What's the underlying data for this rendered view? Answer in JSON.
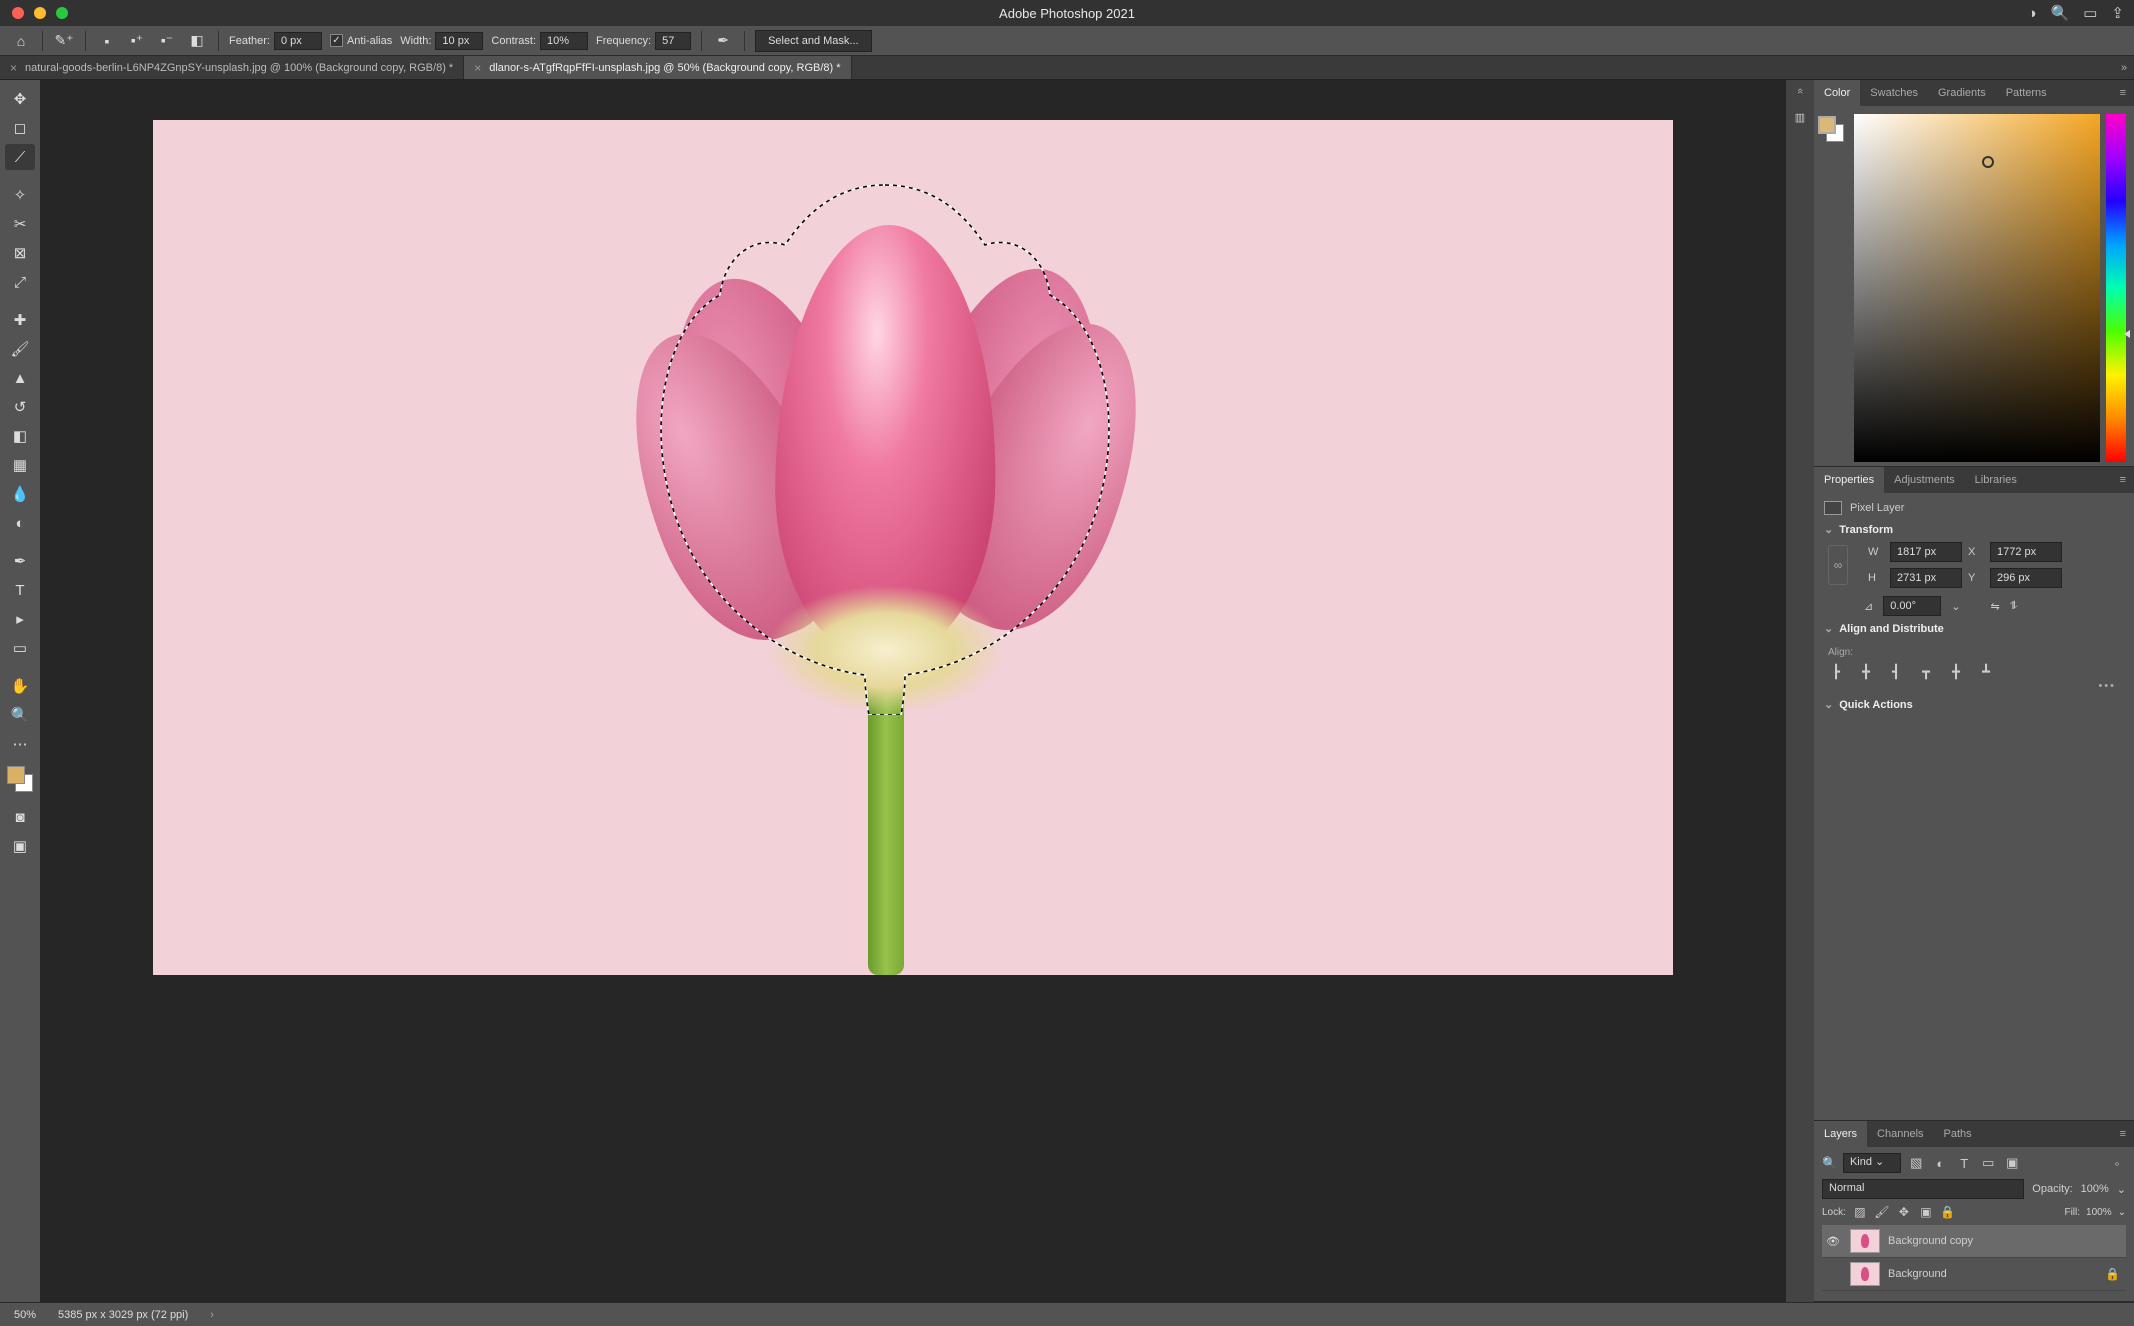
{
  "app": {
    "title": "Adobe Photoshop 2021"
  },
  "optionsbar": {
    "feather_label": "Feather:",
    "feather_value": "0 px",
    "antialias_label": "Anti-alias",
    "width_label": "Width:",
    "width_value": "10 px",
    "contrast_label": "Contrast:",
    "contrast_value": "10%",
    "frequency_label": "Frequency:",
    "frequency_value": "57",
    "select_mask": "Select and Mask..."
  },
  "tabs": {
    "t0": "natural-goods-berlin-L6NP4ZGnpSY-unsplash.jpg @ 100% (Background copy, RGB/8) *",
    "t1": "dlanor-s-ATgfRqpFfFI-unsplash.jpg @ 50% (Background copy, RGB/8) *"
  },
  "panels": {
    "color_tab": "Color",
    "swatches_tab": "Swatches",
    "gradients_tab": "Gradients",
    "patterns_tab": "Patterns",
    "properties_tab": "Properties",
    "adjustments_tab": "Adjustments",
    "libraries_tab": "Libraries",
    "layers_tab": "Layers",
    "channels_tab": "Channels",
    "paths_tab": "Paths"
  },
  "properties": {
    "type": "Pixel Layer",
    "transform_hdr": "Transform",
    "w_value": "1817 px",
    "h_value": "2731 px",
    "x_value": "1772 px",
    "y_value": "296 px",
    "angle": "0.00°",
    "align_hdr": "Align and Distribute",
    "align_label": "Align:",
    "quick_hdr": "Quick Actions",
    "W": "W",
    "H": "H",
    "X": "X",
    "Y": "Y"
  },
  "layers": {
    "kind": "Kind",
    "blend": "Normal",
    "opacity_label": "Opacity:",
    "opacity": "100%",
    "lock_label": "Lock:",
    "fill_label": "Fill:",
    "fill": "100%",
    "layer0": "Background copy",
    "layer1": "Background"
  },
  "status": {
    "zoom": "50%",
    "docinfo": "5385 px x 3029 px (72 ppi)"
  }
}
